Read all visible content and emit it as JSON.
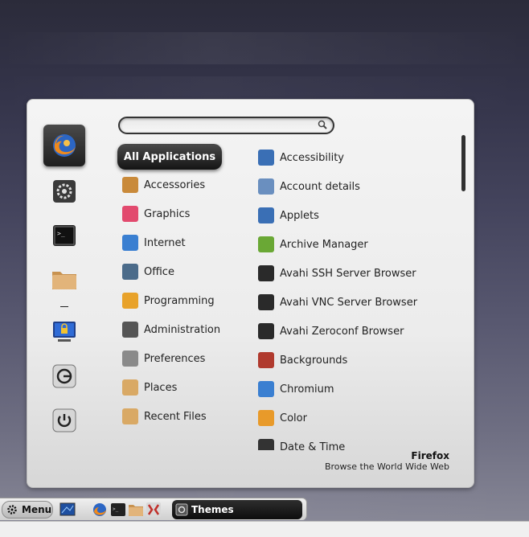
{
  "search": {
    "value": "",
    "placeholder": ""
  },
  "favorites": [
    {
      "name": "firefox-icon"
    },
    {
      "name": "settings-icon"
    },
    {
      "name": "terminal-icon"
    },
    {
      "name": "folder-icon"
    },
    {
      "name": "lock-screen-icon"
    },
    {
      "name": "logout-icon"
    },
    {
      "name": "power-icon"
    }
  ],
  "categories": {
    "all": "All Applications",
    "items": [
      {
        "label": "Accessories",
        "icon": "accessories-icon",
        "color": "#c98a3a"
      },
      {
        "label": "Graphics",
        "icon": "graphics-icon",
        "color": "#e24a6e"
      },
      {
        "label": "Internet",
        "icon": "internet-icon",
        "color": "#3a7fd1"
      },
      {
        "label": "Office",
        "icon": "office-icon",
        "color": "#4b6b8a"
      },
      {
        "label": "Programming",
        "icon": "programming-icon",
        "color": "#e8a22a"
      },
      {
        "label": "Administration",
        "icon": "administration-icon",
        "color": "#555555"
      },
      {
        "label": "Preferences",
        "icon": "preferences-icon",
        "color": "#8a8a8a"
      },
      {
        "label": "Places",
        "icon": "places-folder-icon",
        "color": "#d9a965"
      },
      {
        "label": "Recent Files",
        "icon": "recent-files-icon",
        "color": "#d9a965"
      }
    ]
  },
  "apps": [
    {
      "label": "Accessibility",
      "icon": "accessibility-icon",
      "color": "#3a6fb5"
    },
    {
      "label": "Account details",
      "icon": "account-details-icon",
      "color": "#6a8fbf"
    },
    {
      "label": "Applets",
      "icon": "applets-icon",
      "color": "#3a6fb5"
    },
    {
      "label": "Archive Manager",
      "icon": "archive-manager-icon",
      "color": "#6aa835"
    },
    {
      "label": "Avahi SSH Server Browser",
      "icon": "network-icon",
      "color": "#2a2a2a"
    },
    {
      "label": "Avahi VNC Server Browser",
      "icon": "network-icon",
      "color": "#2a2a2a"
    },
    {
      "label": "Avahi Zeroconf Browser",
      "icon": "network-icon",
      "color": "#2a2a2a"
    },
    {
      "label": "Backgrounds",
      "icon": "backgrounds-icon",
      "color": "#b03a2e"
    },
    {
      "label": "Chromium",
      "icon": "chromium-icon",
      "color": "#3a7fd1"
    },
    {
      "label": "Color",
      "icon": "color-icon",
      "color": "#e89a2a"
    },
    {
      "label": "Date & Time",
      "icon": "date-time-icon",
      "color": "#333333"
    }
  ],
  "description": {
    "title": "Firefox",
    "subtitle": "Browse the World Wide Web"
  },
  "taskbar": {
    "menu_label": "Menu",
    "window_title": "Themes"
  }
}
